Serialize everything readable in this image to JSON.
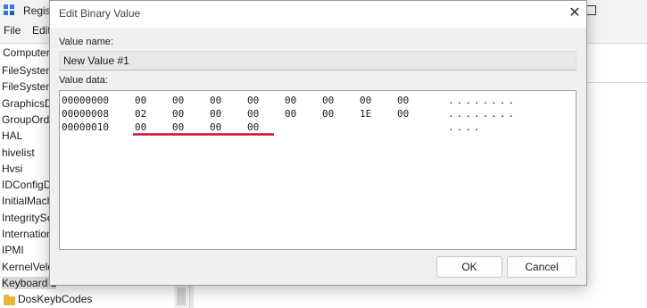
{
  "registry": {
    "title": "Regist",
    "menu": [
      "File",
      "Edit"
    ],
    "address": "Computer",
    "tree": [
      {
        "label": "FileSystem",
        "selected": false
      },
      {
        "label": "FileSystem",
        "selected": false
      },
      {
        "label": "GraphicsD",
        "selected": false
      },
      {
        "label": "GroupOrde",
        "selected": false
      },
      {
        "label": "HAL",
        "selected": false
      },
      {
        "label": "hivelist",
        "selected": false
      },
      {
        "label": "Hvsi",
        "selected": false
      },
      {
        "label": "IDConfigD",
        "selected": false
      },
      {
        "label": "InitialMach",
        "selected": false
      },
      {
        "label": "IntegritySe",
        "selected": false
      },
      {
        "label": "Internation",
        "selected": false
      },
      {
        "label": "IPMI",
        "selected": false
      },
      {
        "label": "KernelVelo",
        "selected": false
      },
      {
        "label": "Keyboard L",
        "selected": true
      },
      {
        "label": "DosKeybCodes",
        "selected": false,
        "folder": true
      }
    ]
  },
  "dialog": {
    "title": "Edit Binary Value",
    "value_name_label": "Value name:",
    "value_name": "New Value #1",
    "value_data_label": "Value data:",
    "rows": [
      {
        "offset": "00000000",
        "bytes": [
          "00",
          "00",
          "00",
          "00",
          "00",
          "00",
          "00",
          "00"
        ],
        "ascii": "........"
      },
      {
        "offset": "00000008",
        "bytes": [
          "02",
          "00",
          "00",
          "00",
          "00",
          "00",
          "1E",
          "00"
        ],
        "ascii": "........"
      },
      {
        "offset": "00000010",
        "bytes": [
          "00",
          "00",
          "00",
          "00"
        ],
        "ascii": "...."
      }
    ],
    "ok_label": "OK",
    "cancel_label": "Cancel",
    "highlight_color": "#c8102e"
  }
}
